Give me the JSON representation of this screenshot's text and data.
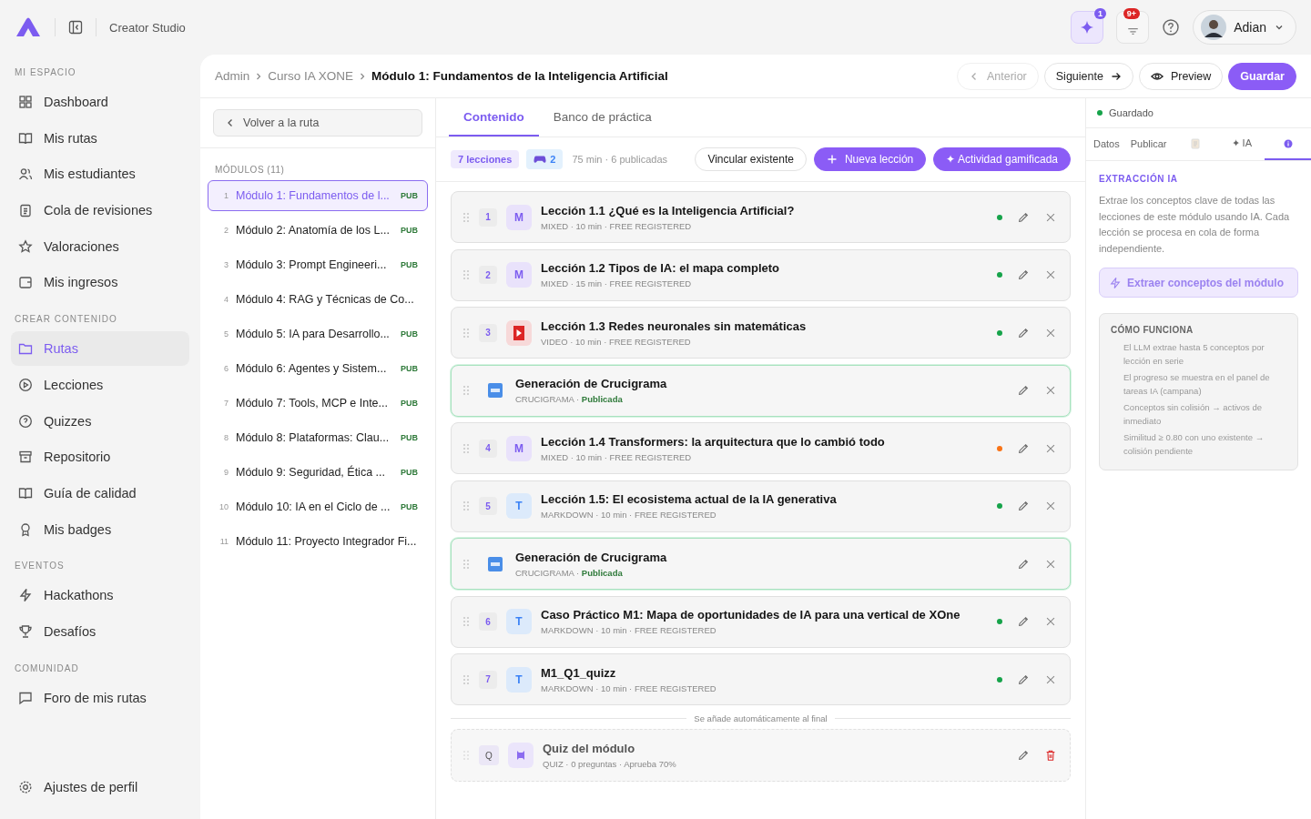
{
  "app": {
    "title": "Creator Studio"
  },
  "topbar": {
    "ai_count": "1",
    "notif_count": "9+",
    "user": "Adian"
  },
  "sidebar": {
    "sections": [
      {
        "title": "MI ESPACIO",
        "items": [
          {
            "label": "Dashboard",
            "selected": false
          },
          {
            "label": "Mis rutas",
            "selected": false
          },
          {
            "label": "Mis estudiantes",
            "selected": false
          },
          {
            "label": "Cola de revisiones",
            "selected": false
          },
          {
            "label": "Valoraciones",
            "selected": false
          },
          {
            "label": "Mis ingresos",
            "selected": false
          }
        ]
      },
      {
        "title": "CREAR CONTENIDO",
        "items": [
          {
            "label": "Rutas",
            "selected": true
          },
          {
            "label": "Lecciones",
            "selected": false
          },
          {
            "label": "Quizzes",
            "selected": false
          },
          {
            "label": "Repositorio",
            "selected": false
          },
          {
            "label": "Guía de calidad",
            "selected": false
          },
          {
            "label": "Mis badges",
            "selected": false
          }
        ]
      },
      {
        "title": "EVENTOS",
        "items": [
          {
            "label": "Hackathons",
            "selected": false
          },
          {
            "label": "Desafíos",
            "selected": false
          }
        ]
      },
      {
        "title": "COMUNIDAD",
        "items": [
          {
            "label": "Foro de mis rutas",
            "selected": false
          }
        ]
      }
    ],
    "footer": "Ajustes de perfil"
  },
  "breadcrumb": [
    "Admin",
    "Curso IA XONE",
    "Módulo 1: Fundamentos de la Inteligencia Artificial"
  ],
  "header_buttons": {
    "prev": "Anterior",
    "prev_disabled": true,
    "next": "Siguiente",
    "preview": "Preview",
    "save": "Guardar"
  },
  "modules": {
    "back": "Volver a la ruta",
    "title": "MÓDULOS (11)",
    "items": [
      {
        "num": "1",
        "title": "Módulo 1: Fundamentos de l...",
        "badge": "PUB",
        "selected": true
      },
      {
        "num": "2",
        "title": "Módulo 2: Anatomía de los L...",
        "badge": "PUB",
        "selected": false
      },
      {
        "num": "3",
        "title": "Módulo 3: Prompt Engineeri...",
        "badge": "PUB",
        "selected": false
      },
      {
        "num": "4",
        "title": "Módulo 4: RAG y Técnicas de Co...",
        "selected": false
      },
      {
        "num": "5",
        "title": "Módulo 5: IA para Desarrollo...",
        "badge": "PUB",
        "selected": false
      },
      {
        "num": "6",
        "title": "Módulo 6: Agentes y Sistem...",
        "badge": "PUB",
        "selected": false
      },
      {
        "num": "7",
        "title": "Módulo 7: Tools, MCP e Inte...",
        "badge": "PUB",
        "selected": false
      },
      {
        "num": "8",
        "title": "Módulo 8: Plataformas: Clau...",
        "badge": "PUB",
        "selected": false
      },
      {
        "num": "9",
        "title": "Módulo 9: Seguridad, Ética ...",
        "badge": "PUB",
        "selected": false
      },
      {
        "num": "10",
        "title": "Módulo 10: IA en el Ciclo de ...",
        "badge": "PUB",
        "selected": false
      },
      {
        "num": "11",
        "title": "Módulo 11: Proyecto Integrador Fi...",
        "selected": false
      }
    ]
  },
  "tabs": [
    {
      "label": "Contenido",
      "selected": true
    },
    {
      "label": "Banco de práctica",
      "selected": false
    }
  ],
  "toolbar": {
    "lessons": "7 lecciones",
    "games": "2",
    "summary": "75 min · 6 publicadas",
    "link": "Vincular existente",
    "new": "Nueva lección",
    "activity": "✦ Actividad gamificada"
  },
  "items": [
    {
      "kind": "lesson",
      "num": "1",
      "badge": {
        "kind": "letter",
        "text": "M"
      },
      "title": "Lección 1.1 ¿Qué es la Inteligencia Artificial?",
      "meta": "MIXED · 10 min · FREE REGISTERED",
      "color": "#16a34a"
    },
    {
      "kind": "lesson",
      "num": "2",
      "badge": {
        "kind": "letter",
        "text": "M"
      },
      "title": "Lección 1.2 Tipos de IA: el mapa completo",
      "meta": "MIXED · 15 min · FREE REGISTERED",
      "color": "#16a34a"
    },
    {
      "kind": "lesson",
      "num": "3",
      "badge": {
        "kind": "video"
      },
      "title": "Lección 1.3 Redes neuronales sin matemáticas",
      "meta": "VIDEO · 10 min · FREE REGISTERED",
      "color": "#16a34a"
    },
    {
      "kind": "activity",
      "title": "Generación de Crucigrama",
      "meta": "CRUCIGRAMA ·",
      "status": "Publicada"
    },
    {
      "kind": "lesson",
      "num": "4",
      "badge": {
        "kind": "letter",
        "text": "M"
      },
      "title": "Lección 1.4 Transformers: la arquitectura que lo cambió todo",
      "meta": "MIXED · 10 min · FREE REGISTERED",
      "color": "#f97316"
    },
    {
      "kind": "lesson",
      "num": "5",
      "badge": {
        "kind": "letter",
        "text": "T"
      },
      "title": "Lección 1.5: El ecosistema actual de la IA generativa",
      "meta": "MARKDOWN · 10 min · FREE REGISTERED",
      "color": "#16a34a"
    },
    {
      "kind": "activity",
      "title": "Generación de Crucigrama",
      "meta": "CRUCIGRAMA ·",
      "status": "Publicada"
    },
    {
      "kind": "lesson",
      "num": "6",
      "badge": {
        "kind": "letter",
        "text": "T"
      },
      "title": "Caso Práctico M1: Mapa de oportunidades de IA para una vertical de XOne",
      "meta": "MARKDOWN · 10 min · FREE REGISTERED",
      "color": "#16a34a"
    },
    {
      "kind": "lesson",
      "num": "7",
      "badge": {
        "kind": "letter",
        "text": "T"
      },
      "title": "M1_Q1_quizz",
      "meta": "MARKDOWN · 10 min · FREE REGISTERED",
      "color": "#16a34a"
    }
  ],
  "quiz": {
    "note": "Se añade automáticamente al final",
    "letter": "Q",
    "title": "Quiz del módulo",
    "meta": "QUIZ · 0 preguntas · Aprueba 70%"
  },
  "panel": {
    "saved": "Guardado",
    "tabs": [
      {
        "kind": "text",
        "label": "Datos",
        "selected": false
      },
      {
        "kind": "text",
        "label": "Publicar",
        "selected": false
      },
      {
        "kind": "doc",
        "selected": false
      },
      {
        "kind": "text",
        "label": "✦ IA",
        "selected": false
      },
      {
        "kind": "info",
        "selected": true
      }
    ],
    "heading": "EXTRACCIÓN IA",
    "text": "Extrae los conceptos clave de todas las lecciones de este módulo usando IA. Cada lección se procesa en cola de forma independiente.",
    "button": "Extraer conceptos del módulo",
    "how_title": "CÓMO FUNCIONA",
    "how": [
      "El LLM extrae hasta 5 conceptos por lección en serie",
      "El progreso se muestra en el panel de tareas IA (campana)",
      "Conceptos sin colisión → activos de inmediato",
      "Similitud ≥ 0.80 con uno existente → colisión pendiente"
    ]
  }
}
